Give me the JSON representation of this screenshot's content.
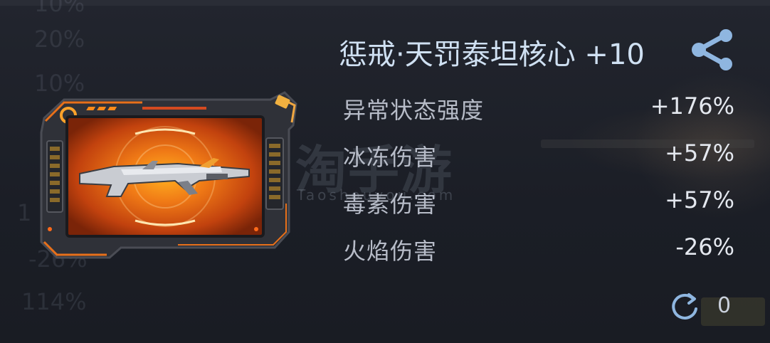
{
  "background": {
    "percentages": [
      "10%",
      "20%",
      "10%",
      "1",
      "-26%",
      "114%"
    ]
  },
  "watermark": {
    "main": "淘手游",
    "sub": "Taoshouyou.com"
  },
  "item": {
    "title": "惩戒·天罚泰坦核心 +10",
    "image_icon": "rifle-weapon-icon",
    "accent_color": "#e8701a",
    "frame_color": "#3a3c44"
  },
  "stats": [
    {
      "label": "异常状态强度",
      "value": "+176%"
    },
    {
      "label": "冰冻伤害",
      "value": "+57%"
    },
    {
      "label": "毒素伤害",
      "value": "+57%"
    },
    {
      "label": "火焰伤害",
      "value": "-26%"
    }
  ],
  "actions": {
    "share_icon": "share-icon",
    "reroll_icon": "refresh-icon",
    "reroll_count": "0"
  },
  "colors": {
    "title": "#cfe0f2",
    "label": "#b7bcc8",
    "value": "#e4e8ef",
    "icon": "#8fb6e0"
  }
}
